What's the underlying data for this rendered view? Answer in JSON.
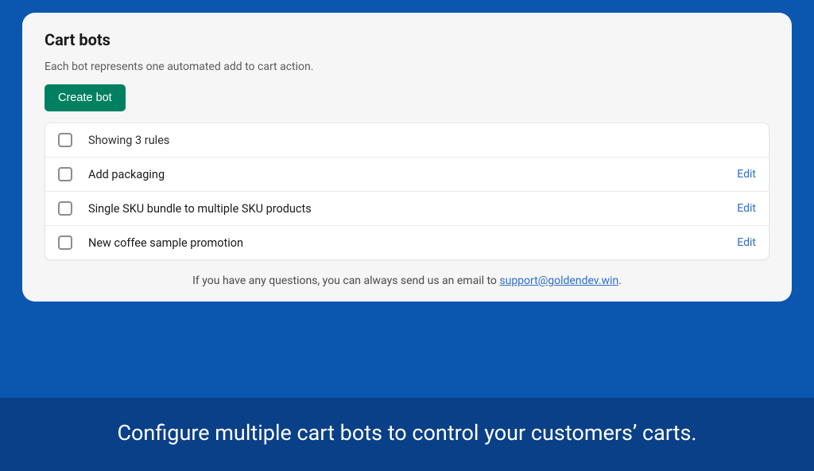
{
  "panel": {
    "title": "Cart bots",
    "description": "Each bot represents one automated add to cart action.",
    "create_button": "Create bot",
    "header_text": "Showing 3 rules",
    "rules": [
      {
        "label": "Add packaging",
        "edit": "Edit"
      },
      {
        "label": "Single SKU bundle to multiple SKU products",
        "edit": "Edit"
      },
      {
        "label": "New coffee sample promotion",
        "edit": "Edit"
      }
    ],
    "footer_prefix": "If you have any questions, you can always send us an email to ",
    "footer_email": "support@goldendev.win",
    "footer_suffix": "."
  },
  "banner_text": "Configure multiple cart bots to control your customers’ carts."
}
